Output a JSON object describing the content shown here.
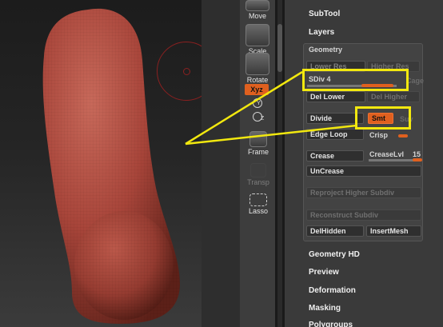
{
  "shelf": {
    "move_label": "Move",
    "scale_label": "Scale",
    "rotate_label": "Rotate",
    "xyz_label": "Xyz",
    "y_label": "Y",
    "z_label": "Z",
    "frame_label": "Frame",
    "transp_label": "Transp",
    "lasso_label": "Lasso"
  },
  "palette": {
    "subtool_label": "SubTool",
    "layers_label": "Layers",
    "geometry": {
      "title": "Geometry",
      "lower_res": "Lower Res",
      "higher_res": "Higher Res",
      "sdiv_label": "SDiv 4",
      "sdiv_value": 0.9,
      "cage_label": "Cage",
      "del_lower": "Del Lower",
      "del_higher": "Del Higher",
      "divide": "Divide",
      "smt": "Smt",
      "suv": "Suv",
      "edge_loop": "Edge Loop",
      "crisp": "Crisp",
      "crease": "Crease",
      "crease_lvl_label": "CreaseLvl",
      "crease_lvl_value": "15",
      "uncrease": "UnCrease",
      "reproject": "Reproject Higher Subdiv",
      "reconstruct": "Reconstruct Subdiv",
      "del_hidden": "DelHidden",
      "insert_mesh": "InsertMesh"
    },
    "geometry_hd_label": "Geometry HD",
    "preview_label": "Preview",
    "deformation_label": "Deformation",
    "masking_label": "Masking",
    "polygroups_label": "Polygroups"
  },
  "colors": {
    "accent": "#e0601f",
    "highlight": "#f2e80f",
    "mesh": "#a8453a",
    "brush_circle": "#8a2020"
  }
}
